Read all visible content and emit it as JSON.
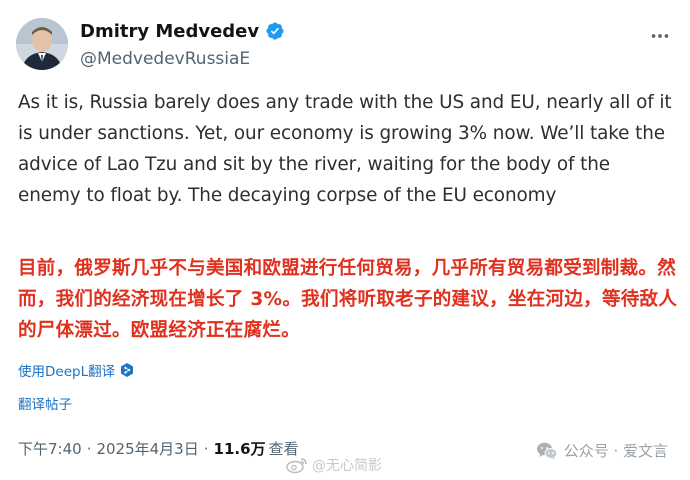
{
  "author": {
    "display_name": "Dmitry Medvedev",
    "handle": "@MedvedevRussiaE",
    "verified": true,
    "verified_badge_color": "#1d9bf0"
  },
  "post": {
    "text": "As it is, Russia barely does any trade with the US and EU, nearly all of it is under sanctions. Yet, our economy is growing 3% now. We’ll take the advice of Lao Tzu and sit by the river, waiting for the body of the enemy to float by. The decaying corpse of the EU economy",
    "translation": "目前，俄罗斯几乎不与美国和欧盟进行任何贸易，几乎所有贸易都受到制裁。然而，我们的经济现在增长了 3%。我们将听取老子的建议，坐在河边，等待敌人的尸体漂过。欧盟经济正在腐烂。",
    "translation_color": "#e0301e",
    "translated_with": "使用DeepL翻译",
    "translate_post_link": "翻译帖子",
    "link_color": "#1d73c4"
  },
  "meta": {
    "time": "下午7:40",
    "separator": "·",
    "date": "2025年4月3日",
    "views_count": "11.6万",
    "views_label": "查看"
  },
  "icons": {
    "more": "more-horizontal-icon",
    "verified": "verified-badge-icon",
    "deepl": "deepl-icon",
    "wechat": "wechat-icon",
    "weibo": "weibo-icon"
  },
  "watermarks": {
    "official_account": "公众号 · 爱文言",
    "weibo": "@无心简影"
  }
}
